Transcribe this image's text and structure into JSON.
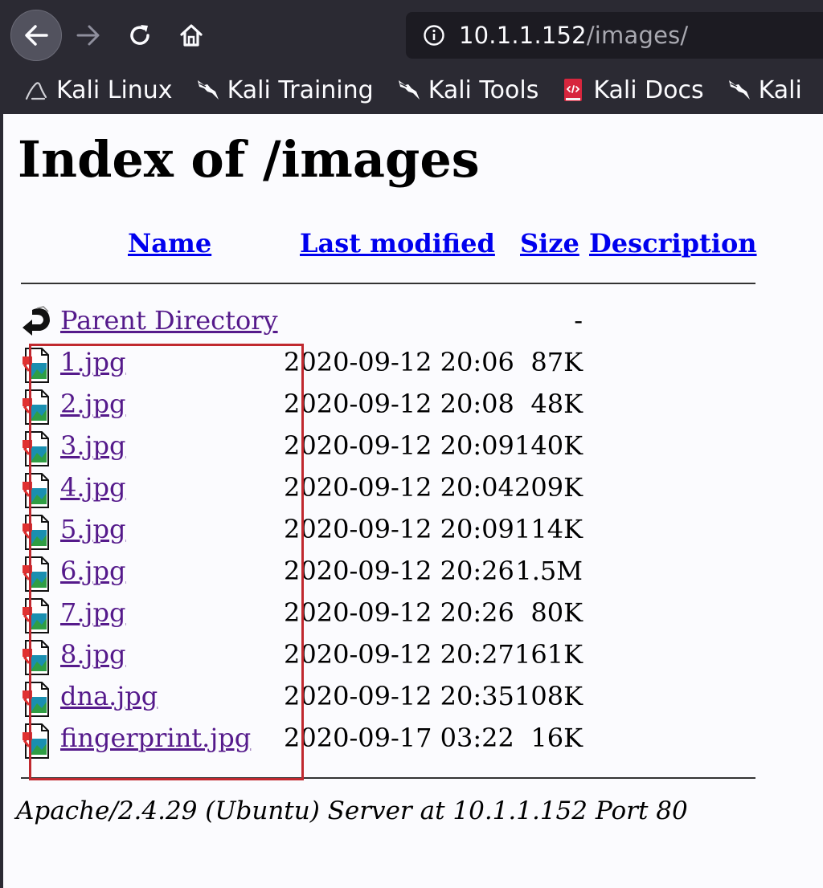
{
  "browser": {
    "url_host": "10.1.1.152",
    "url_path": "/images/",
    "bookmarks": [
      {
        "label": "Kali Linux",
        "icon": "kali-linux-icon"
      },
      {
        "label": "Kali Training",
        "icon": "kali-dragon-icon"
      },
      {
        "label": "Kali Tools",
        "icon": "kali-dragon-icon"
      },
      {
        "label": "Kali Docs",
        "icon": "kali-docs-icon"
      },
      {
        "label": "Kali",
        "icon": "kali-dragon-icon"
      }
    ]
  },
  "page": {
    "title": "Index of /images",
    "columns": {
      "name": "Name",
      "last_modified": "Last modified",
      "size": "Size",
      "description": "Description"
    },
    "parent": {
      "name": "Parent Directory",
      "size": "-"
    },
    "files": [
      {
        "name": "1.jpg",
        "modified": "2020-09-12 20:06",
        "size": "87K"
      },
      {
        "name": "2.jpg",
        "modified": "2020-09-12 20:08",
        "size": "48K"
      },
      {
        "name": "3.jpg",
        "modified": "2020-09-12 20:09",
        "size": "140K"
      },
      {
        "name": "4.jpg",
        "modified": "2020-09-12 20:04",
        "size": "209K"
      },
      {
        "name": "5.jpg",
        "modified": "2020-09-12 20:09",
        "size": "114K"
      },
      {
        "name": "6.jpg",
        "modified": "2020-09-12 20:26",
        "size": "1.5M"
      },
      {
        "name": "7.jpg",
        "modified": "2020-09-12 20:26",
        "size": "80K"
      },
      {
        "name": "8.jpg",
        "modified": "2020-09-12 20:27",
        "size": "161K"
      },
      {
        "name": "dna.jpg",
        "modified": "2020-09-12 20:35",
        "size": "108K"
      },
      {
        "name": "fingerprint.jpg",
        "modified": "2020-09-17 03:22",
        "size": "16K"
      }
    ],
    "server_signature": "Apache/2.4.29 (Ubuntu) Server at 10.1.1.152 Port 80"
  },
  "colors": {
    "chrome_bg": "#2b2a33",
    "link": "#0000ee",
    "visited_link": "#551a8b",
    "highlight_box": "#c0292f"
  }
}
